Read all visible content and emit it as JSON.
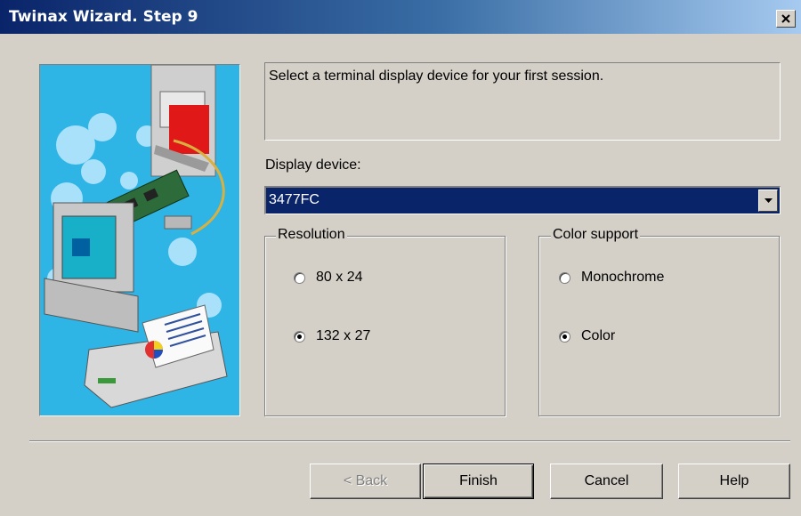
{
  "window": {
    "title": "Twinax Wizard. Step 9"
  },
  "instruction": "Select a terminal display device for your first session.",
  "display_device": {
    "label": "Display device:",
    "value": "3477FC"
  },
  "resolution": {
    "legend": "Resolution",
    "options": [
      {
        "label": "80 x 24",
        "selected": false
      },
      {
        "label": "132 x 27",
        "selected": true
      }
    ]
  },
  "color_support": {
    "legend": "Color support",
    "options": [
      {
        "label": "Monochrome",
        "selected": false
      },
      {
        "label": "Color",
        "selected": true
      }
    ]
  },
  "buttons": {
    "back": "< Back",
    "finish": "Finish",
    "cancel": "Cancel",
    "help": "Help"
  },
  "icons": {
    "close": "close-icon",
    "dropdown": "chevron-down-icon"
  },
  "colors": {
    "title_start": "#0a246a",
    "title_end": "#a6caf0",
    "face": "#d4d0c8",
    "selection": "#0a246a",
    "illustration_bg": "#2fb4e6"
  }
}
